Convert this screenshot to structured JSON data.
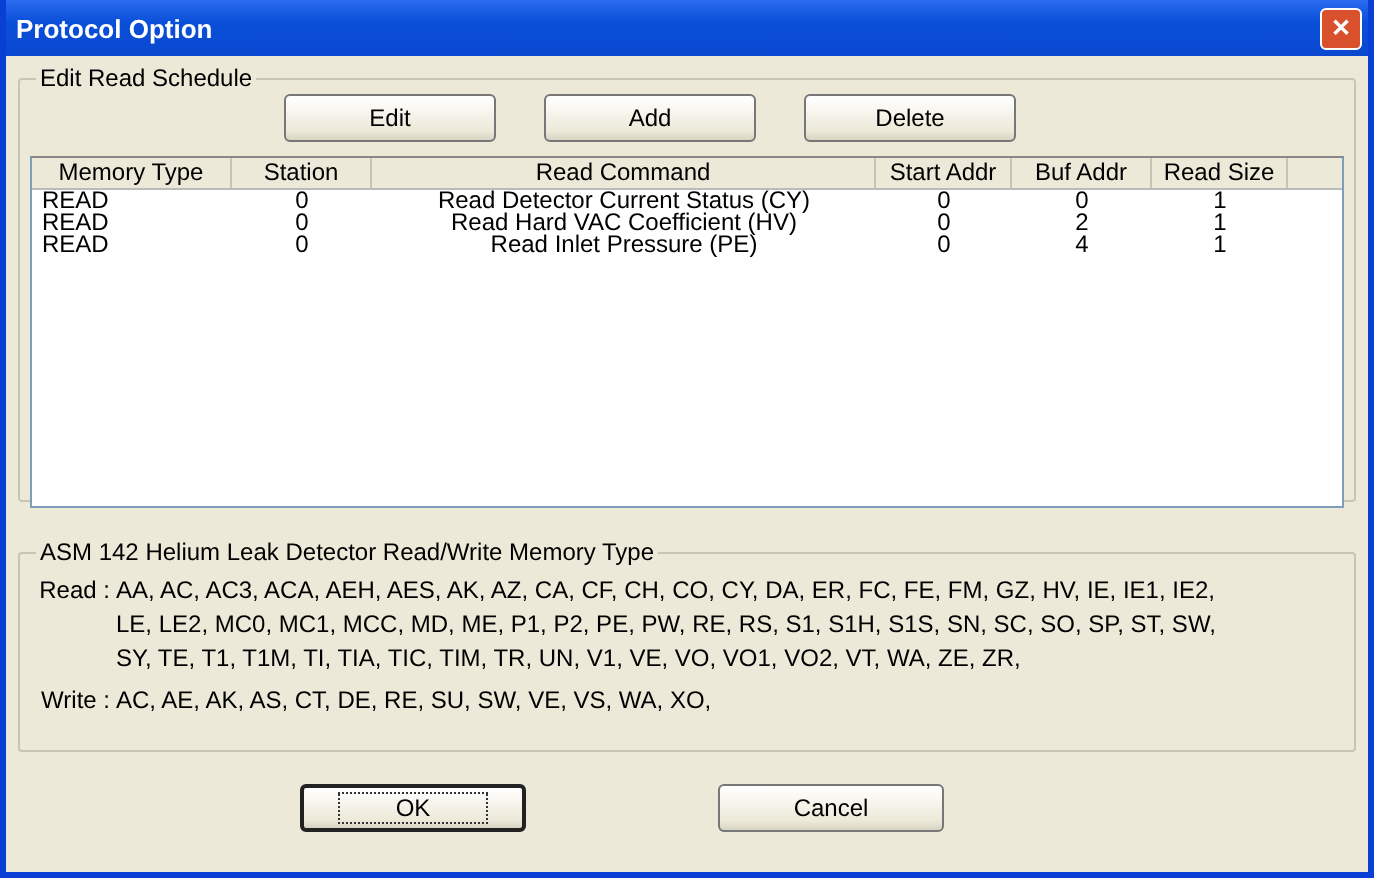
{
  "window": {
    "title": "Protocol Option",
    "close": "✕"
  },
  "schedule": {
    "title": "Edit Read Schedule",
    "buttons": [
      "Edit",
      "Add",
      "Delete"
    ],
    "columns": [
      "Memory Type",
      "Station",
      "Read Command",
      "Start Addr",
      "Buf Addr",
      "Read Size"
    ],
    "rows": [
      {
        "cells": [
          "READ",
          "0",
          "Read Detector Current Status (CY)",
          "0",
          "0",
          "1"
        ]
      },
      {
        "cells": [
          "READ",
          "0",
          "Read Hard VAC Coefficient (HV)",
          "0",
          "2",
          "1"
        ]
      },
      {
        "cells": [
          "READ",
          "0",
          "Read Inlet Pressure (PE)",
          "0",
          "4",
          "1"
        ]
      }
    ]
  },
  "memory": {
    "title": "ASM 142 Helium Leak Detector Read/Write Memory Type",
    "entries": [
      {
        "label": "Read :",
        "lines": [
          "AA, AC, AC3, ACA, AEH, AES, AK, AZ, CA, CF, CH, CO, CY, DA, ER, FC, FE, FM, GZ, HV, IE, IE1, IE2,",
          "LE, LE2, MC0, MC1, MCC, MD, ME, P1, P2, PE, PW, RE, RS, S1, S1H, S1S, SN, SC, SO, SP, ST, SW,",
          "SY, TE, T1, T1M, TI, TIA, TIC, TIM, TR, UN, V1, VE, VO, VO1, VO2, VT, WA, ZE, ZR,"
        ]
      },
      {
        "label": "Write :",
        "lines": [
          "AC, AE, AK, AS, CT, DE, RE, SU, SW, VE, VS, WA, XO,"
        ]
      }
    ]
  },
  "footer": [
    {
      "label": "OK",
      "selected": true
    },
    {
      "label": "Cancel",
      "selected": false
    }
  ]
}
